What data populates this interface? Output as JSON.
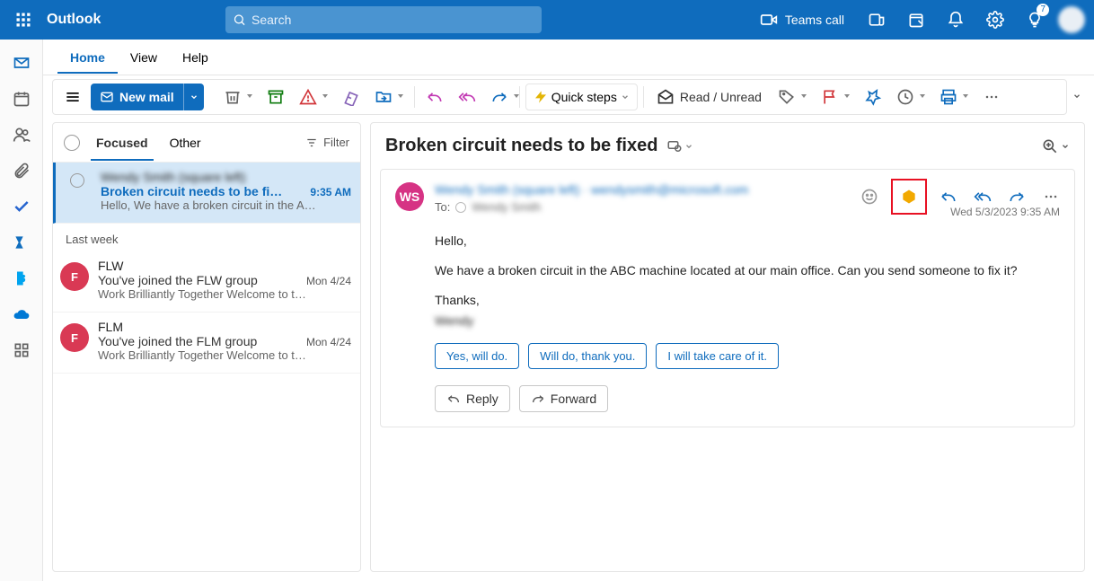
{
  "topbar": {
    "brand": "Outlook",
    "search_placeholder": "Search",
    "teams_call": "Teams call",
    "notify_badge": "7"
  },
  "tabs": {
    "home": "Home",
    "view": "View",
    "help": "Help"
  },
  "ribbon": {
    "new_mail": "New mail",
    "quick_steps": "Quick steps",
    "read_unread": "Read / Unread"
  },
  "msglist": {
    "focused": "Focused",
    "other": "Other",
    "filter": "Filter",
    "group_last_week": "Last week",
    "items": [
      {
        "sender": "Wendy Smith (square left)",
        "subject": "Broken circuit needs to be fi…",
        "time": "9:35 AM",
        "preview": "Hello, We have a broken circuit in the A…"
      },
      {
        "avatar": "F",
        "sender": "FLW",
        "subject": "You've joined the FLW group",
        "time": "Mon 4/24",
        "preview": "Work Brilliantly Together Welcome to t…"
      },
      {
        "avatar": "F",
        "sender": "FLM",
        "subject": "You've joined the FLM group",
        "time": "Mon 4/24",
        "preview": "Work Brilliantly Together Welcome to t…"
      }
    ]
  },
  "reading": {
    "title": "Broken circuit needs to be fixed",
    "avatar_initials": "WS",
    "from_redacted": "Wendy Smith (square left) · wendysmith@microsoft.com",
    "to_label": "To:",
    "to_redacted": "Wendy Smith",
    "timestamp": "Wed 5/3/2023 9:35 AM",
    "body_hello": "Hello,",
    "body_main": "We have a broken circuit in the ABC machine located at   our main office. Can you send someone to fix it?",
    "body_thanks": "Thanks,",
    "body_sig": "Wendy",
    "suggested": [
      "Yes, will do.",
      "Will do, thank you.",
      "I will take care of it."
    ],
    "reply": "Reply",
    "forward": "Forward"
  }
}
